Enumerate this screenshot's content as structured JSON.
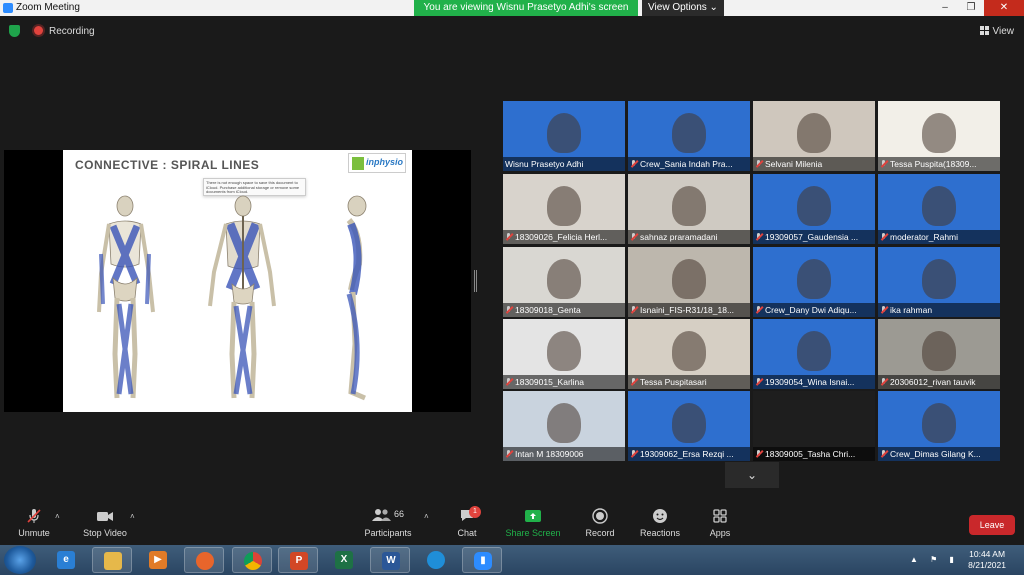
{
  "window": {
    "title": "Zoom Meeting",
    "controls": [
      "–",
      "❐",
      "✕"
    ]
  },
  "banner": {
    "viewing": "You are viewing Wisnu Prasetyo Adhi's screen",
    "view_options": "View Options ⌄"
  },
  "status": {
    "recording": "Recording",
    "view": "View"
  },
  "slide": {
    "title": "CONNECTIVE : SPIRAL LINES",
    "logo": "inphysio",
    "note": "There is not enough space to save this document to iCloud. Purchase additional storage or remove some documents from iCloud."
  },
  "participants": [
    {
      "name": "Wisnu Prasetyo Adhi",
      "muted": false,
      "bg": "#2e6fcf"
    },
    {
      "name": "Crew_Sania Indah Pra...",
      "muted": true,
      "bg": "#2e6fcf"
    },
    {
      "name": "Selvani Milenia",
      "muted": true,
      "bg": "#cfc7bd"
    },
    {
      "name": "Tessa Puspita(18309...",
      "muted": true,
      "bg": "#f2efe8"
    },
    {
      "name": "18309026_Felicia Herl...",
      "muted": true,
      "bg": "#d8d3cc"
    },
    {
      "name": "sahnaz praramadani",
      "muted": true,
      "bg": "#cfcac2"
    },
    {
      "name": "19309057_Gaudensia ...",
      "muted": true,
      "bg": "#2e6fcf"
    },
    {
      "name": "moderator_Rahmi",
      "muted": true,
      "bg": "#2e6fcf"
    },
    {
      "name": "18309018_Genta",
      "muted": true,
      "bg": "#d9d7d2"
    },
    {
      "name": "Isnaini_FIS-R31/18_18...",
      "muted": true,
      "bg": "#bdb7ad"
    },
    {
      "name": "Crew_Dany Dwi Adiqu...",
      "muted": true,
      "bg": "#2e6fcf"
    },
    {
      "name": "ika rahman",
      "muted": true,
      "bg": "#2e6fcf"
    },
    {
      "name": "18309015_Karlina",
      "muted": true,
      "bg": "#e4e4e4"
    },
    {
      "name": "Tessa Puspitasari",
      "muted": true,
      "bg": "#d6cfc4"
    },
    {
      "name": "19309054_Wina Isnai...",
      "muted": true,
      "bg": "#2e6fcf"
    },
    {
      "name": "20306012_rivan tauvik",
      "muted": true,
      "bg": "#9c9a93"
    },
    {
      "name": "Intan M 18309006",
      "muted": true,
      "bg": "#c9d3de"
    },
    {
      "name": "19309062_Ersa Rezqi ...",
      "muted": true,
      "bg": "#2e6fcf"
    },
    {
      "name": "18309005_Tasha Chri...",
      "muted": true,
      "bg": "#1e1e1e"
    },
    {
      "name": "Crew_Dimas Gilang K...",
      "muted": true,
      "bg": "#2e6fcf"
    }
  ],
  "toolbar": {
    "unmute": "Unmute",
    "stop_video": "Stop Video",
    "participants": "Participants",
    "participants_count": "66",
    "chat": "Chat",
    "chat_badge": "1",
    "share_screen": "Share Screen",
    "record": "Record",
    "reactions": "Reactions",
    "apps": "Apps",
    "leave": "Leave",
    "share_color": "#21b14a",
    "leave_color": "#c9282b"
  },
  "taskbar": {
    "apps": [
      "ie-icon",
      "explorer-icon",
      "media-player-icon",
      "firefox-icon",
      "chrome-icon",
      "powerpoint-icon",
      "excel-icon",
      "word-icon",
      "edge-icon",
      "zoom-icon"
    ],
    "time": "10:44 AM",
    "date": "8/21/2021"
  }
}
